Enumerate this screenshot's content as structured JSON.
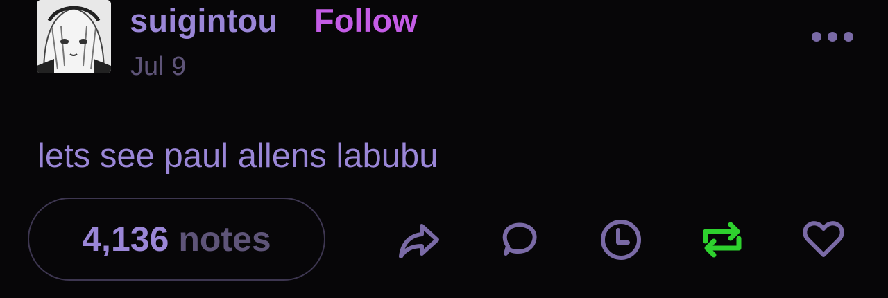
{
  "post": {
    "username": "suigintou",
    "follow_label": "Follow",
    "date": "Jul 9",
    "text": "lets see paul allens labubu",
    "notes_count": "4,136",
    "notes_label": "notes"
  },
  "icons": {
    "more": "more-horizontal-icon",
    "share": "share-arrow-icon",
    "reply": "comment-bubble-icon",
    "queue": "clock-icon",
    "reblog": "reblog-icon",
    "like": "heart-icon"
  },
  "colors": {
    "background": "#070608",
    "username": "#9a86d7",
    "follow": "#c45ce6",
    "muted": "#5e5478",
    "icon": "#7a6aa6",
    "reblog_active": "#2ed12e"
  }
}
